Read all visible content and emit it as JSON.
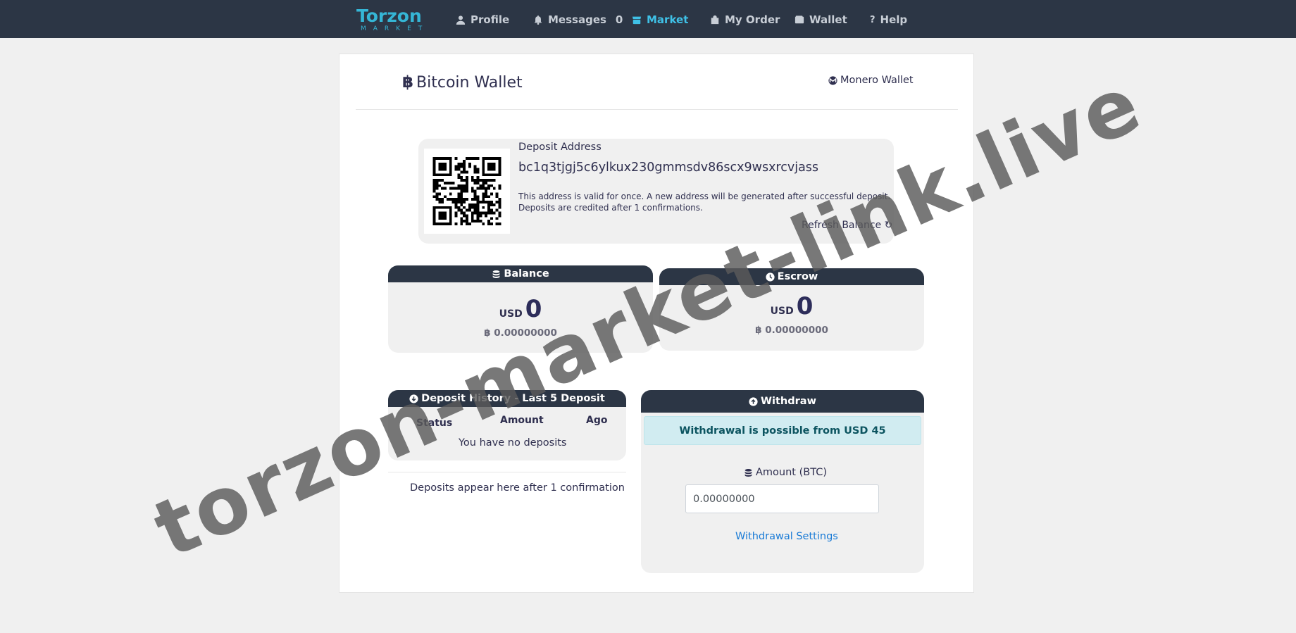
{
  "nav": {
    "logo_main": "Torzon",
    "logo_sub": "MARKET",
    "items": [
      {
        "label": "Profile",
        "icon": "user-icon"
      },
      {
        "label": "Messages",
        "icon": "bell-icon",
        "count": "0"
      },
      {
        "label": "Market",
        "icon": "store-icon",
        "active": true
      },
      {
        "label": "My Order",
        "icon": "bag-icon"
      },
      {
        "label": "Wallet",
        "icon": "wallet-icon"
      },
      {
        "label": "Help",
        "icon": "question-icon"
      }
    ],
    "bg_color": "#2c3645",
    "active_color": "#3fc1e7"
  },
  "wallet": {
    "title_symbol": "฿",
    "title": "Bitcoin Wallet",
    "monero_link": "Monero Wallet"
  },
  "deposit": {
    "label": "Deposit Address",
    "address": "bc1q3tjgj5c6ylkux230gmmsdv86scx9wsxrcvjass",
    "note_1": "This address is valid for once. A new address will be generated after successful deposit.",
    "note_2": "Deposits are credited after 1 confirmations.",
    "refresh": "Refresh Balance ↻"
  },
  "balance": {
    "title": "Balance",
    "currency": "USD",
    "value": "0",
    "btc": "฿ 0.00000000"
  },
  "escrow": {
    "title": "Escrow",
    "currency": "USD",
    "value": "0",
    "btc": "฿ 0.00000000"
  },
  "history": {
    "title": "Deposit History - Last 5 Deposit",
    "columns": [
      "Status",
      "Amount",
      "Ago"
    ],
    "empty": "You have no deposits",
    "footer": "Deposits appear here after 1 confirmation"
  },
  "withdraw": {
    "title": "Withdraw",
    "alert": "Withdrawal is possible from USD 45",
    "amount_label": "Amount (BTC)",
    "amount_value": "0.00000000",
    "settings_link": "Withdrawal Settings"
  },
  "watermark": "torzon-market-link.live"
}
